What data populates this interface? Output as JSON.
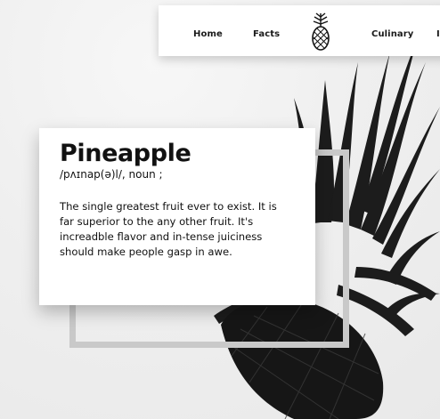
{
  "nav": {
    "home": "Home",
    "facts": "Facts",
    "culinary": "Culinary",
    "more": "I"
  },
  "definition": {
    "word": "Pineapple",
    "pronunciation": "/pʌɪnap(ə)l/, noun ;",
    "description": "The single greatest fruit ever to exist. It is far superior to the any other fruit. It's increadble flavor and in-tense juiciness should make people gasp in awe."
  },
  "colors": {
    "background": "#efefef",
    "card": "#ffffff",
    "frame": "#c9c9c9",
    "text": "#111111"
  },
  "icons": {
    "logo": "pineapple-logo-icon"
  }
}
